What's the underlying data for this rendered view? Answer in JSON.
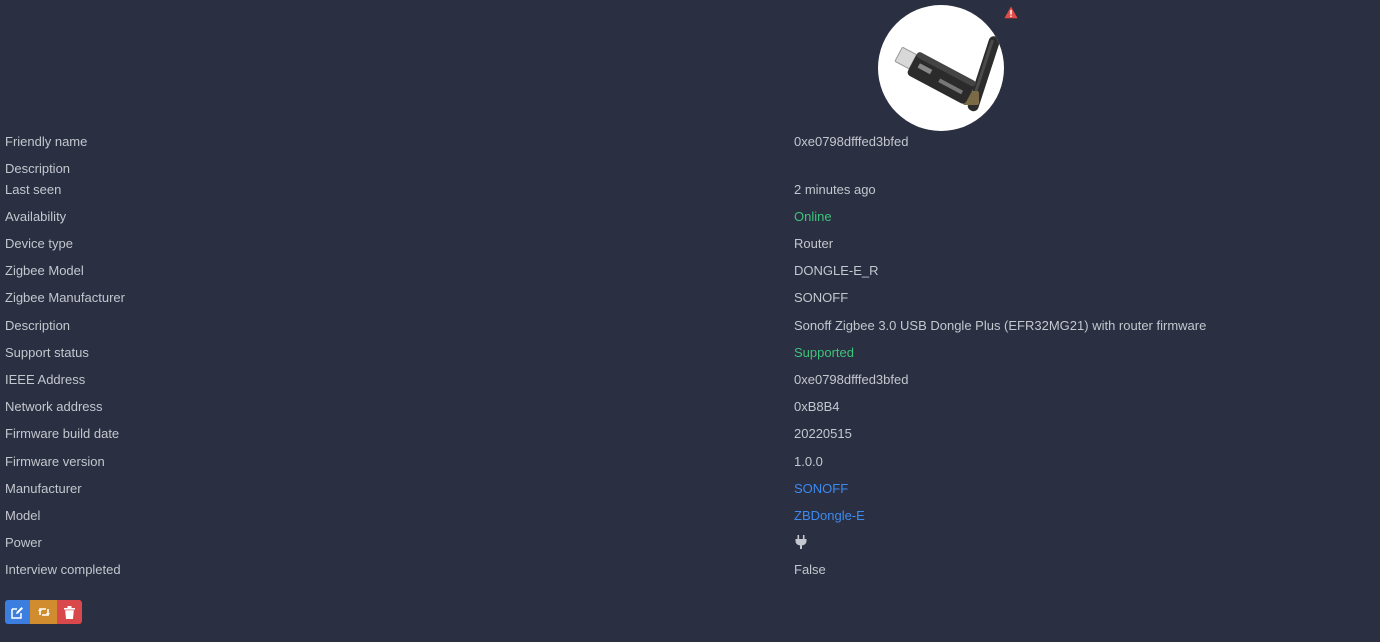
{
  "device": {
    "image_alt": "device-image",
    "warning_color": "#e24b46"
  },
  "rows": [
    {
      "label": "Friendly name",
      "value": "0xe0798dfffed3bfed",
      "style": "plain"
    },
    {
      "label": "Description",
      "value": "",
      "style": "plain"
    },
    {
      "label": "Last seen",
      "value": "2 minutes ago",
      "style": "plain"
    },
    {
      "label": "Availability",
      "value": "Online",
      "style": "green"
    },
    {
      "label": "Device type",
      "value": "Router",
      "style": "plain"
    },
    {
      "label": "Zigbee Model",
      "value": "DONGLE-E_R",
      "style": "plain"
    },
    {
      "label": "Zigbee Manufacturer",
      "value": "SONOFF",
      "style": "plain"
    },
    {
      "label": "Description",
      "value": "Sonoff Zigbee 3.0 USB Dongle Plus (EFR32MG21) with router firmware",
      "style": "plain"
    },
    {
      "label": "Support status",
      "value": "Supported",
      "style": "green"
    },
    {
      "label": "IEEE Address",
      "value": "0xe0798dfffed3bfed",
      "style": "plain"
    },
    {
      "label": "Network address",
      "value": "0xB8B4",
      "style": "plain"
    },
    {
      "label": "Firmware build date",
      "value": "20220515",
      "style": "plain"
    },
    {
      "label": "Firmware version",
      "value": "1.0.0",
      "style": "plain"
    },
    {
      "label": "Manufacturer",
      "value": "SONOFF",
      "style": "link"
    },
    {
      "label": "Model",
      "value": "ZBDongle-E",
      "style": "link"
    },
    {
      "label": "Power",
      "value": "",
      "icon": "plug-icon",
      "style": "plain"
    },
    {
      "label": "Interview completed",
      "value": "False",
      "style": "plain"
    }
  ],
  "actions": {
    "edit_icon": "edit-icon",
    "refresh_icon": "refresh-icon",
    "delete_icon": "trash-icon",
    "colors": {
      "edit": "#3c7ee0",
      "refresh": "#d08c2f",
      "delete": "#d9484a"
    }
  }
}
